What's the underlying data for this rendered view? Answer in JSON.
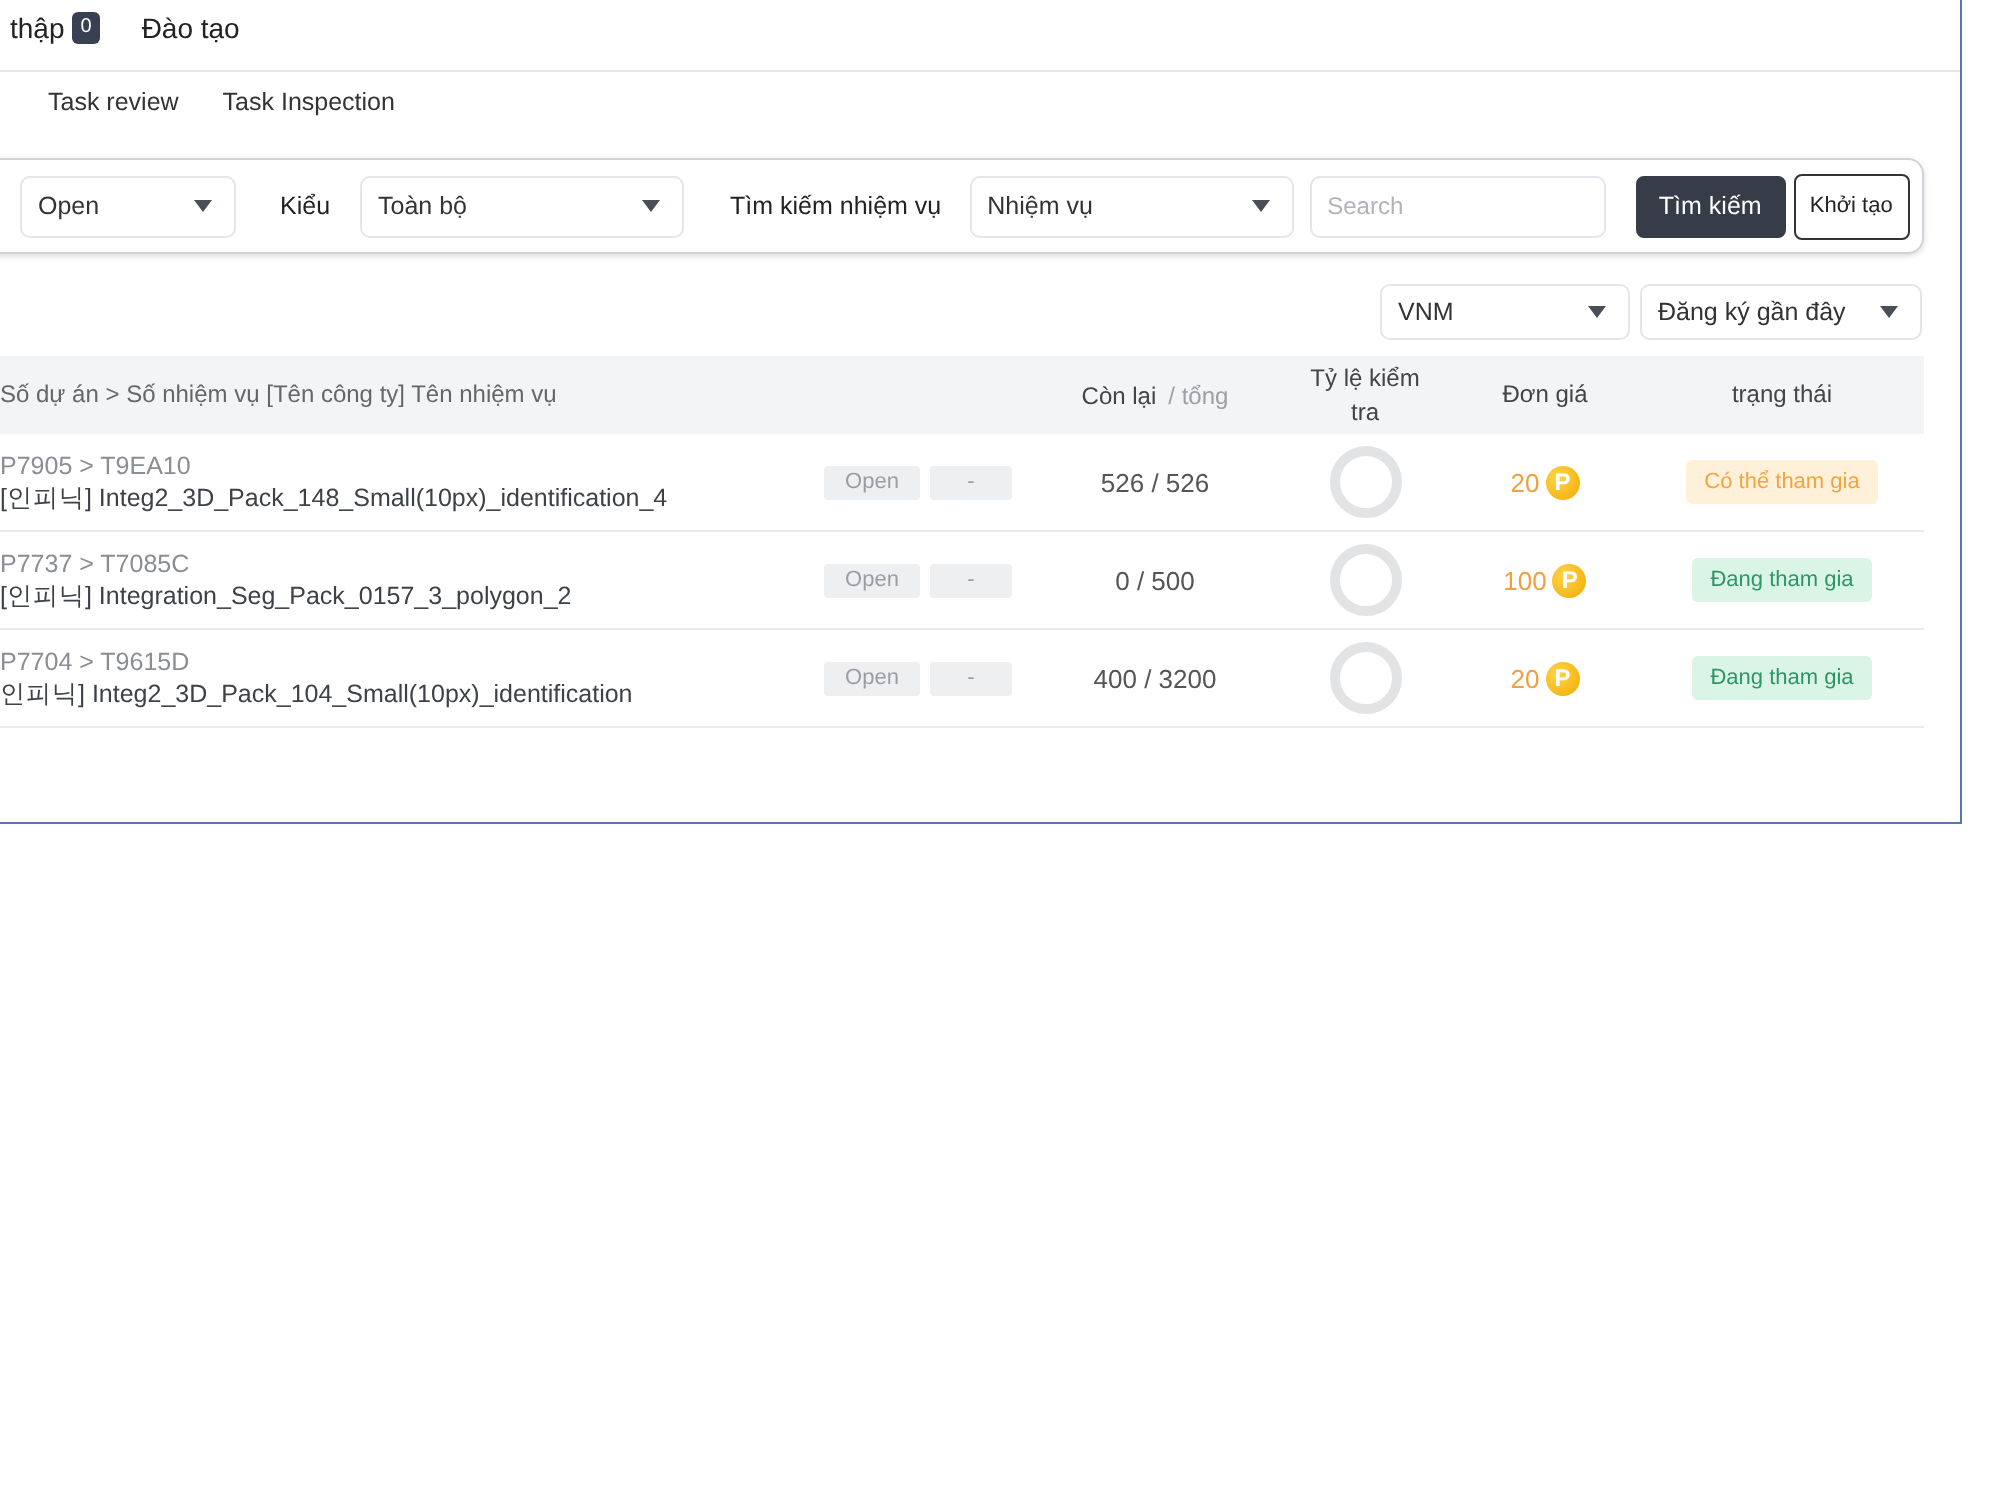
{
  "top_tabs": [
    {
      "label": "thập",
      "badge": "0",
      "selected": false
    },
    {
      "label": "Đào tạo",
      "selected": false
    }
  ],
  "sub_tabs": [
    {
      "label": "Task review",
      "selected": false
    },
    {
      "label": "Task Inspection",
      "selected": false
    }
  ],
  "filters": {
    "status_select": "Open",
    "type_label": "Kiểu",
    "type_select": "Toàn bộ",
    "task_search_label": "Tìm kiếm nhiệm vụ",
    "task_search_select": "Nhiệm vụ",
    "search": {
      "placeholder": "Search"
    },
    "buttons": [
      {
        "label": "Tìm kiếm",
        "kind": "primary"
      },
      {
        "label": "Khởi tạo",
        "kind": "outline"
      }
    ]
  },
  "sort": {
    "region_select": "VNM",
    "order_select": "Đăng ký gần đây"
  },
  "table": {
    "columns": [
      {
        "label": "Số dự án > Số nhiệm vụ [Tên công ty] Tên nhiệm vụ"
      },
      {
        "label": "Còn lại",
        "secondary": "/ tổng"
      },
      {
        "label": "Tỷ lệ kiểm tra"
      },
      {
        "label": "Đơn giá"
      },
      {
        "label": "trạng thái"
      }
    ],
    "rows": [
      {
        "path": "P7905 > T9EA10",
        "name": "[인피닉] Integ2_3D_Pack_148_Small(10px)_identification_4",
        "tags": [
          "Open",
          "-"
        ],
        "count": "526 / 526",
        "price": "20",
        "coin": "P",
        "status": {
          "kind": "available",
          "label": "Có thể tham gia"
        }
      },
      {
        "path": "P7737 > T7085C",
        "name": "[인피닉] Integration_Seg_Pack_0157_3_polygon_2",
        "tags": [
          "Open",
          "-"
        ],
        "count": "0 / 500",
        "price": "100",
        "coin": "P",
        "status": {
          "kind": "joined",
          "label": "Đang tham gia"
        }
      },
      {
        "path": "P7704 > T9615D",
        "name": "인피닉] Integ2_3D_Pack_104_Small(10px)_identification",
        "tags": [
          "Open",
          "-"
        ],
        "count": "400 / 3200",
        "price": "20",
        "coin": "P",
        "status": {
          "kind": "joined",
          "label": "Đang tham gia"
        }
      }
    ]
  }
}
